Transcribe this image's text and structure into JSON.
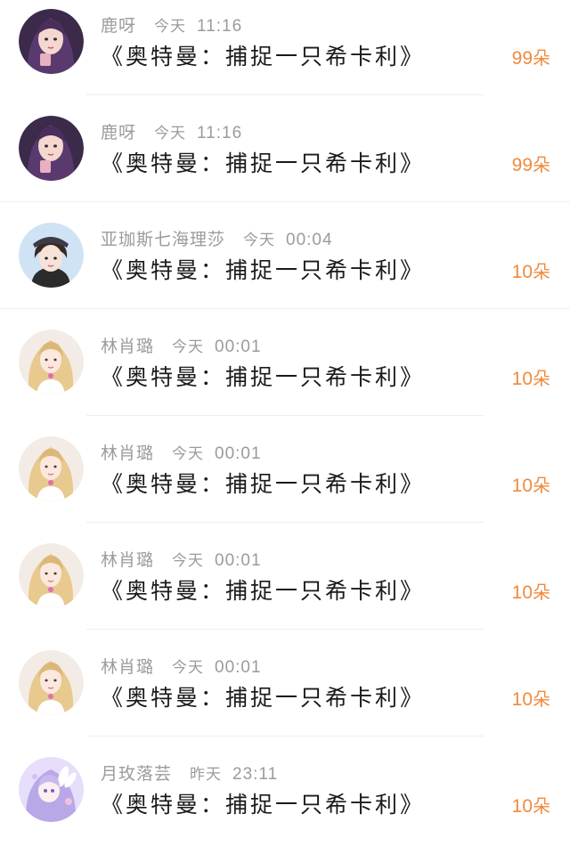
{
  "gifts": [
    {
      "name": "鹿呀",
      "day": "今天",
      "time": "11:16",
      "message": "《奥特曼：捕捉一只希卡利》",
      "count": "99",
      "unit": "朵",
      "avatar": "avatar-purple-hair-girl"
    },
    {
      "name": "鹿呀",
      "day": "今天",
      "time": "11:16",
      "message": "《奥特曼：捕捉一只希卡利》",
      "count": "99",
      "unit": "朵",
      "avatar": "avatar-purple-hair-girl"
    },
    {
      "name": "亚珈斯七海理莎",
      "day": "今天",
      "time": "00:04",
      "message": "《奥特曼：捕捉一只希卡利》",
      "count": "10",
      "unit": "朵",
      "avatar": "avatar-cap-girl"
    },
    {
      "name": "林肖璐",
      "day": "今天",
      "time": "00:01",
      "message": "《奥特曼：捕捉一只希卡利》",
      "count": "10",
      "unit": "朵",
      "avatar": "avatar-blonde-girl"
    },
    {
      "name": "林肖璐",
      "day": "今天",
      "time": "00:01",
      "message": "《奥特曼：捕捉一只希卡利》",
      "count": "10",
      "unit": "朵",
      "avatar": "avatar-blonde-girl"
    },
    {
      "name": "林肖璐",
      "day": "今天",
      "time": "00:01",
      "message": "《奥特曼：捕捉一只希卡利》",
      "count": "10",
      "unit": "朵",
      "avatar": "avatar-blonde-girl"
    },
    {
      "name": "林肖璐",
      "day": "今天",
      "time": "00:01",
      "message": "《奥特曼：捕捉一只希卡利》",
      "count": "10",
      "unit": "朵",
      "avatar": "avatar-blonde-girl"
    },
    {
      "name": "月玫落芸",
      "day": "昨天",
      "time": "23:11",
      "message": "《奥特曼：捕捉一只希卡利》",
      "count": "10",
      "unit": "朵",
      "avatar": "avatar-anime-bunny-girl"
    }
  ],
  "colors": {
    "count": "#f08a3c",
    "meta": "#9b9b9b",
    "message": "#1a1a1a",
    "divider": "#eeeeee"
  }
}
